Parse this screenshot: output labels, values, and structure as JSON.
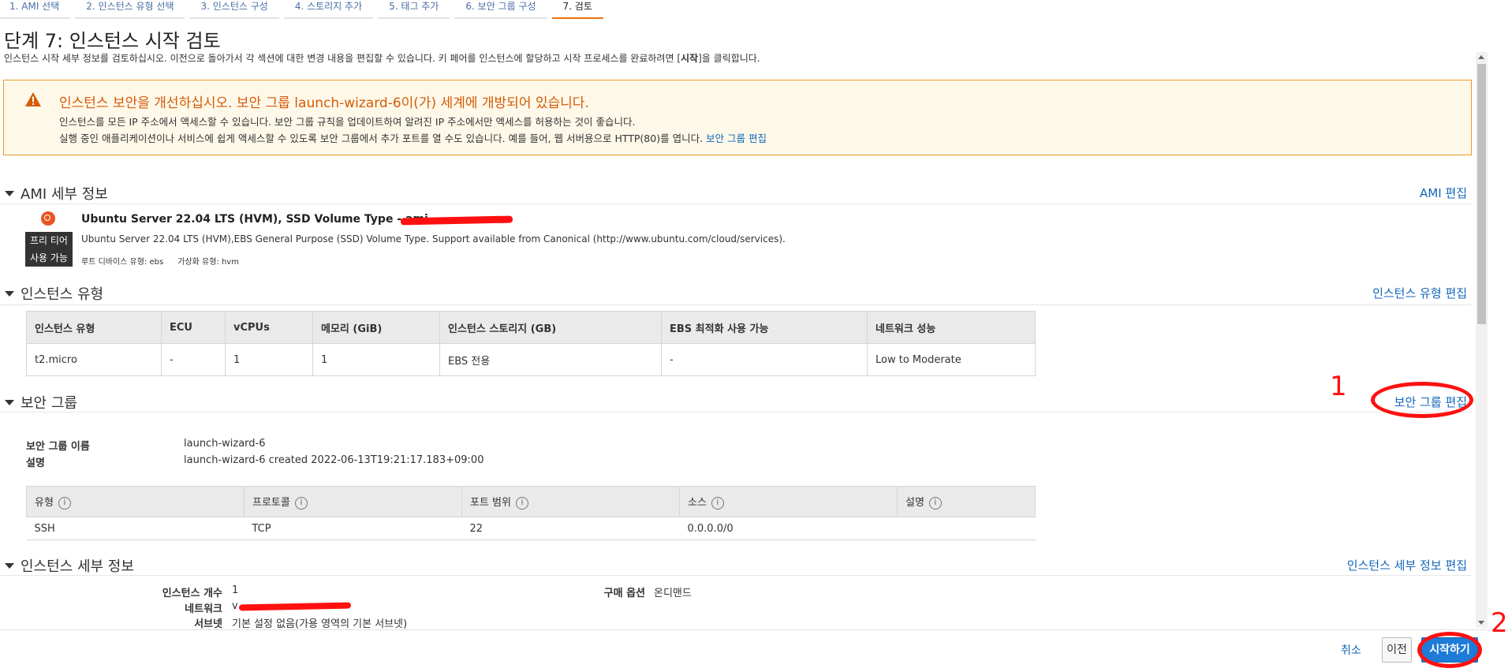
{
  "tabs": [
    {
      "label": "1. AMI 선택"
    },
    {
      "label": "2. 인스턴스 유형 선택"
    },
    {
      "label": "3. 인스턴스 구성"
    },
    {
      "label": "4. 스토리지 추가"
    },
    {
      "label": "5. 태그 추가"
    },
    {
      "label": "6. 보안 그룹 구성"
    },
    {
      "label": "7. 검토"
    }
  ],
  "page": {
    "title": "단계 7: 인스턴스 시작 검토",
    "subtitle_before": "인스턴스 시작 세부 정보를 검토하십시오. 이전으로 돌아가서 각 섹션에 대한 변경 내용을 편집할 수 있습니다. 키 페어를 인스턴스에 할당하고 시작 프로세스를 완료하려면 [",
    "subtitle_bold": "시작",
    "subtitle_after": "]을 클릭합니다."
  },
  "warning": {
    "title": "인스턴스 보안을 개선하십시오. 보안 그룹 launch-wizard-6이(가) 세계에 개방되어 있습니다.",
    "line1": "인스턴스를 모든 IP 주소에서 액세스할 수 있습니다. 보안 그룹 규칙을 업데이트하여 알려진 IP 주소에서만 액세스를 허용하는 것이 좋습니다.",
    "line2": "실행 중인 애플리케이션이나 서비스에 쉽게 액세스할 수 있도록 보안 그룹에서 추가 포트를 열 수도 있습니다. 예를 들어, 웹 서버용으로 HTTP(80)를 엽니다.",
    "link": "보안 그룹 편집",
    "color": "#eb9a28"
  },
  "ami": {
    "header": "AMI 세부 정보",
    "edit": "AMI 편집",
    "badge_line1": "프리 티어",
    "badge_line2": "사용 가능",
    "name": "Ubuntu Server 22.04 LTS (HVM), SSD Volume Type - ami-",
    "description": "Ubuntu Server 22.04 LTS (HVM),EBS General Purpose (SSD) Volume Type. Support available from Canonical (http://www.ubuntu.com/cloud/services).",
    "root_device": "루트 디바이스 유형: ebs",
    "virtualization": "가상화 유형: hvm"
  },
  "instance_type": {
    "header": "인스턴스 유형",
    "edit": "인스턴스 유형 편집",
    "columns": [
      "인스턴스 유형",
      "ECU",
      "vCPUs",
      "메모리 (GiB)",
      "인스턴스 스토리지 (GB)",
      "EBS 최적화 사용 가능",
      "네트워크 성능"
    ],
    "row": [
      "t2.micro",
      "-",
      "1",
      "1",
      "EBS 전용",
      "-",
      "Low to Moderate"
    ]
  },
  "security_group": {
    "header": "보안 그룹",
    "edit": "보안 그룹 편집",
    "name_label": "보안 그룹 이름",
    "name_value": "launch-wizard-6",
    "desc_label": "설명",
    "desc_value": "launch-wizard-6 created 2022-06-13T19:21:17.183+09:00",
    "columns": [
      "유형",
      "프로토콜",
      "포트 범위",
      "소스",
      "설명"
    ],
    "info_glyph": "i",
    "row": [
      "SSH",
      "TCP",
      "22",
      "0.0.0.0/0",
      ""
    ]
  },
  "instance_details": {
    "header": "인스턴스 세부 정보",
    "edit": "인스턴스 세부 정보 편집",
    "count_label": "인스턴스 개수",
    "count_value": "1",
    "network_label": "네트워크",
    "network_value": "v",
    "subnet_label": "서브넷",
    "subnet_value": "기본 설정 없음(가용 영역의 기본 서브넷)",
    "purchase_label": "구매 옵션",
    "purchase_value": "온디맨드"
  },
  "footer": {
    "cancel": "취소",
    "previous": "이전",
    "launch": "시작하기"
  },
  "annotations": {
    "mark1": "1",
    "mark2": "2",
    "color": "#ff1010"
  }
}
